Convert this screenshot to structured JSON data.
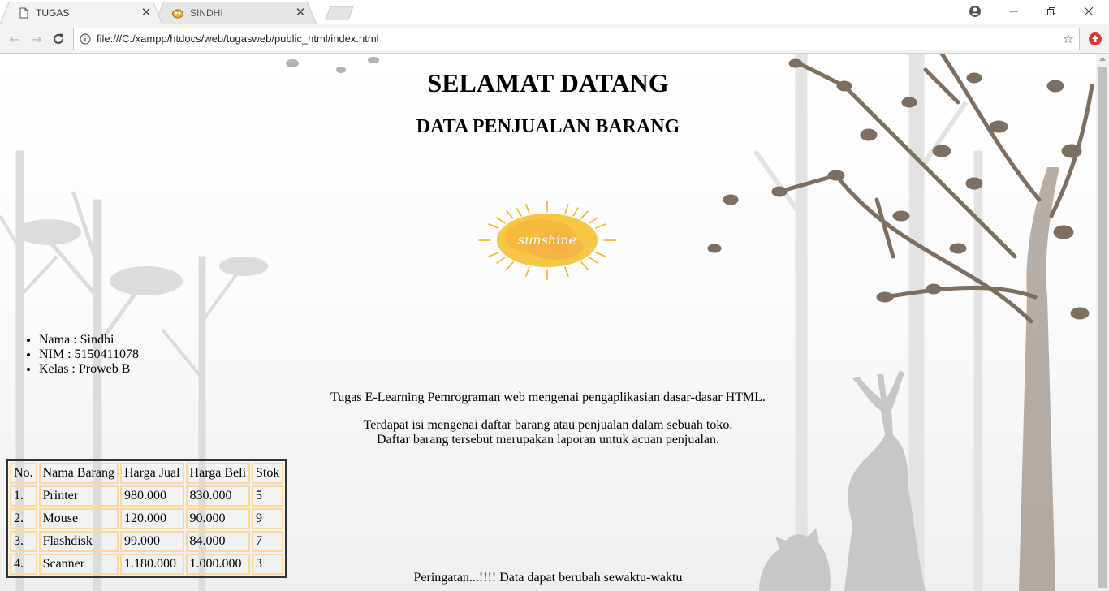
{
  "browser": {
    "tabs": [
      {
        "title": "TUGAS",
        "active": true
      },
      {
        "title": "SINDHI",
        "active": false
      }
    ],
    "url": "file:///C:/xampp/htdocs/web/tugasweb/public_html/index.html"
  },
  "page": {
    "title": "SELAMAT DATANG",
    "subtitle": "DATA PENJUALAN BARANG",
    "logo_text": "sunshine",
    "identity": [
      "Nama : Sindhi",
      "NIM : 5150411078",
      "Kelas : Proweb B"
    ],
    "intro": "Tugas E-Learning Pemrograman web mengenai pengaplikasian dasar-dasar HTML.",
    "description_1": "Terdapat isi mengenai daftar barang atau penjualan dalam sebuah toko.",
    "description_2": "Daftar barang tersebut merupakan laporan untuk acuan penjualan.",
    "warning": "Peringatan...!!!! Data dapat berubah sewaktu-waktu"
  },
  "table": {
    "headers": [
      "No.",
      "Nama Barang",
      "Harga Jual",
      "Harga Beli",
      "Stok"
    ],
    "rows": [
      [
        "1.",
        "Printer",
        "980.000",
        "830.000",
        "5"
      ],
      [
        "2.",
        "Mouse",
        "120.000",
        "90.000",
        "9"
      ],
      [
        "3.",
        "Flashdisk",
        "99.000",
        "84.000",
        "7"
      ],
      [
        "4.",
        "Scanner",
        "1.180.000",
        "1.000.000",
        "3"
      ]
    ]
  },
  "colors": {
    "cell_border": "#fad7a0",
    "table_border": "#333333",
    "tree_dark": "#7d6e62",
    "tree_light": "#d9d9d9"
  }
}
